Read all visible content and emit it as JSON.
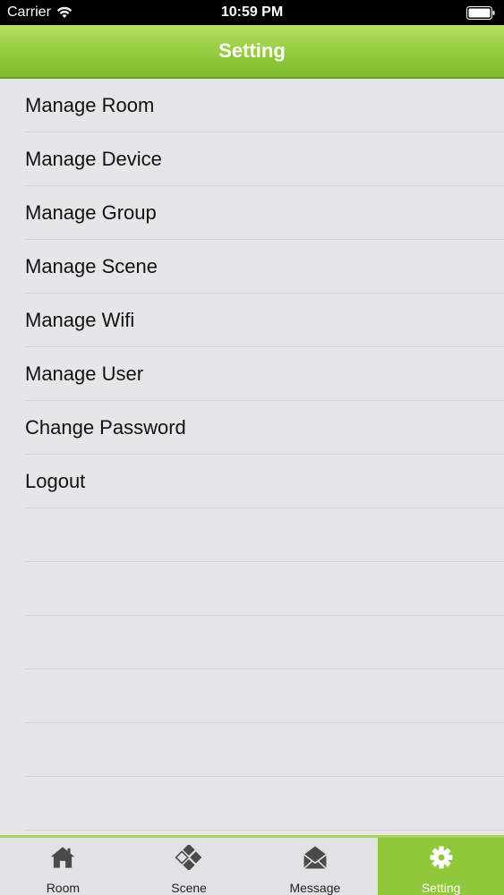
{
  "status_bar": {
    "carrier": "Carrier",
    "time": "10:59 PM",
    "wifi_icon": "wifi-icon",
    "battery_icon": "battery-icon"
  },
  "nav": {
    "title": "Setting"
  },
  "menu": {
    "items": [
      {
        "label": "Manage Room"
      },
      {
        "label": "Manage Device"
      },
      {
        "label": "Manage Group"
      },
      {
        "label": "Manage Scene"
      },
      {
        "label": "Manage Wifi"
      },
      {
        "label": "Manage User"
      },
      {
        "label": "Change Password"
      },
      {
        "label": "Logout"
      }
    ]
  },
  "tabs": [
    {
      "label": "Room",
      "icon": "home-icon"
    },
    {
      "label": "Scene",
      "icon": "scene-icon"
    },
    {
      "label": "Message",
      "icon": "envelope-icon"
    },
    {
      "label": "Setting",
      "icon": "gear-icon",
      "active": true
    }
  ],
  "colors": {
    "accent": "#8fc83a",
    "nav_gradient_top": "#b8e06a",
    "nav_gradient_bottom": "#7eb92c",
    "background": "#e6e6e9"
  }
}
